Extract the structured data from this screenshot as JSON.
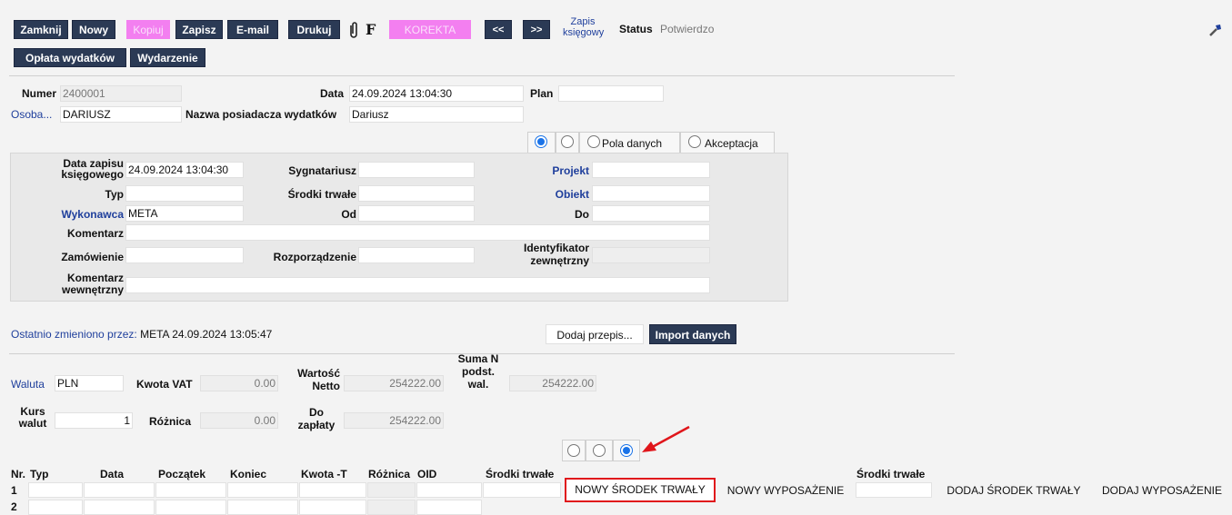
{
  "toolbar": {
    "close": "Zamknij",
    "new": "Nowy",
    "copy": "Kopiuj",
    "save": "Zapisz",
    "email": "E-mail",
    "print": "Drukuj",
    "attach_icon": "paperclip-icon",
    "f_label": "F",
    "correction": "KOREKTA",
    "prev": "<<",
    "next": ">>",
    "accounting_entry_line1": "Zapis",
    "accounting_entry_line2": "księgowy",
    "status_label": "Status",
    "status_value": "Potwierdzo",
    "expense_payment": "Opłata wydatków",
    "event": "Wydarzenie",
    "tool_icon": "wrench-icon"
  },
  "header": {
    "number_label": "Numer",
    "number_value": "2400001",
    "date_label": "Data",
    "date_value": "24.09.2024 13:04:30",
    "plan_label": "Plan",
    "plan_value": "",
    "person_label": "Osoba...",
    "person_value": "DARIUSZ",
    "holder_label": "Nazwa posiadacza wydatków",
    "holder_value": "Dariusz"
  },
  "tabs": {
    "fields_label": "Pola danych",
    "approval_label": "Akceptacja"
  },
  "details": {
    "entry_date_label_1": "Data zapisu",
    "entry_date_label_2": "księgowego",
    "entry_date_value": "24.09.2024 13:04:30",
    "signatory_label": "Sygnatariusz",
    "signatory_value": "",
    "project_label": "Projekt",
    "project_value": "",
    "type_label": "Typ",
    "type_value": "",
    "fixed_assets_label": "Środki trwałe",
    "fixed_assets_value": "",
    "object_label": "Obiekt",
    "object_value": "",
    "contractor_label": "Wykonawca",
    "contractor_value": "META",
    "from_label": "Od",
    "from_value": "",
    "to_label": "Do",
    "to_value": "",
    "comment_label": "Komentarz",
    "comment_value": "",
    "order_label": "Zamówienie",
    "order_value": "",
    "regulation_label": "Rozporządzenie",
    "regulation_value": "",
    "ext_id_label_1": "Identyfikator",
    "ext_id_label_2": "zewnętrzny",
    "ext_id_value": "",
    "internal_comment_label_1": "Komentarz",
    "internal_comment_label_2": "wewnętrzny",
    "internal_comment_value": ""
  },
  "footer": {
    "last_changed_label": "Ostatnio zmieniono przez:",
    "last_changed_value": "META 24.09.2024 13:05:47",
    "add_recipe": "Dodaj przepis...",
    "import_data": "Import danych"
  },
  "totals": {
    "currency_label": "Waluta",
    "currency_value": "PLN",
    "vat_label": "Kwota VAT",
    "vat_value": "0.00",
    "net_label_1": "Wartość",
    "net_label_2": "Netto",
    "net_value": "254222.00",
    "sum_label_1": "Suma N",
    "sum_label_2": "podst.",
    "sum_label_3": "wal.",
    "sum_value": "254222.00",
    "rate_label_1": "Kurs",
    "rate_label_2": "walut",
    "rate_value": "1",
    "diff_label": "Różnica",
    "diff_value": "0.00",
    "topay_label_1": "Do",
    "topay_label_2": "zapłaty",
    "topay_value": "254222.00"
  },
  "grid": {
    "col_nr": "Nr.",
    "col_type": "Typ",
    "col_date": "Data",
    "col_start": "Początek",
    "col_end": "Koniec",
    "col_amount": "Kwota -T",
    "col_diff": "Różnica",
    "col_oid": "OID",
    "col_assets": "Środki trwałe",
    "col_assets2": "Środki trwałe",
    "row1_nr": "1",
    "row2_nr": "2",
    "new_asset": "NOWY ŚRODEK TRWAŁY",
    "new_equipment": "NOWY WYPOSAŻENIE",
    "add_asset": "DODAJ ŚRODEK TRWAŁY",
    "add_equipment": "DODAJ WYPOSAŻENIE"
  },
  "colors": {
    "toolbar_button": "#2b3a55",
    "disabled_button": "#f37ff0",
    "link": "#1f3f9c",
    "highlight_box": "#e0161b",
    "arrow": "#e0161b"
  }
}
